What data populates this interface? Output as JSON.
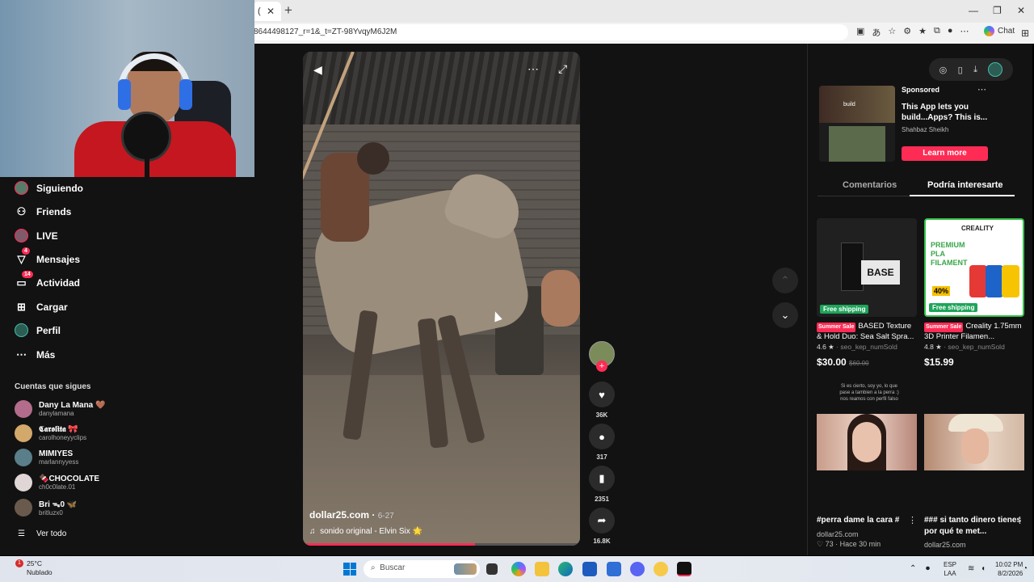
{
  "browser": {
    "tab_label": "(",
    "address": "8644498127_r=1&_t=ZT-98YvqyM6J2M",
    "chat_label": "Chat",
    "window_controls": [
      "—",
      "❐",
      "✕"
    ]
  },
  "sidebar": {
    "items": [
      {
        "label": "Siguiendo",
        "icon": "avatar-icon"
      },
      {
        "label": "Friends",
        "icon": "people-icon"
      },
      {
        "label": "LIVE",
        "icon": "live-icon"
      },
      {
        "label": "Mensajes",
        "icon": "send-icon",
        "badge": "4"
      },
      {
        "label": "Actividad",
        "icon": "inbox-icon",
        "badge": "14"
      },
      {
        "label": "Cargar",
        "icon": "upload-icon"
      },
      {
        "label": "Perfil",
        "icon": "profile-icon"
      },
      {
        "label": "Más",
        "icon": "more-icon"
      }
    ],
    "following_title": "Cuentas que sigues",
    "following": [
      {
        "name": "Dany La Mana 🤎",
        "user": "danylamana"
      },
      {
        "name": "𝕮𝖆𝖗𝖔𝖑𝖎𝖙𝖆 🎀",
        "user": "carolhoneyyclips"
      },
      {
        "name": "MIMIYES",
        "user": "marlannyyess"
      },
      {
        "name": "🍫CHOCOLATE",
        "user": "ch0c0late.01"
      },
      {
        "name": "Bri ᯓ0 🦋",
        "user": "britluzx0"
      }
    ],
    "see_all": "Ver todo"
  },
  "video": {
    "author": "dollar25.com",
    "date": "6-27",
    "sound": "sonido original - Elvin Six 🌟",
    "progress": 0.62
  },
  "actions": {
    "likes": "36K",
    "comments": "317",
    "saves": "2351",
    "shares": "16.8K"
  },
  "ad": {
    "sponsored": "Sponsored",
    "title": "This App lets you build...Apps? This is...",
    "author": "Shahbaz Sheikh",
    "cta": "Learn more",
    "thumb_text": "build"
  },
  "right_tabs": {
    "comments": "Comentarios",
    "related": "Podría interesarte"
  },
  "products": [
    {
      "shipping": "Free shipping",
      "sale": "Summer Sale",
      "title": "BASED Texture & Hold Duo: Sea Salt Spra...",
      "rating": "4.6 ★",
      "sold": "seo_kep_numSold",
      "price": "$30.00",
      "old_price": "$60.00",
      "img_text": "BASE"
    },
    {
      "shipping": "Free shipping",
      "sale": "Summer Sale",
      "title": "Creality 1.75mm 3D Printer Filamen...",
      "rating": "4.8 ★",
      "sold": "seo_kep_numSold",
      "price": "$15.99",
      "img_text": "PREMIUM PLA FILAMENT",
      "brand": "CREALITY",
      "discount": "40%"
    }
  ],
  "videos": [
    {
      "title": "#perra dame la cara #",
      "author": "dollar25.com",
      "meta": "♡ 73 · Hace 30 min"
    },
    {
      "title": "### si tanto dinero tienes por qué te met...",
      "author": "dollar25.com"
    }
  ],
  "faint_caption": "Si es cierto, soy yo, lo que pase a tambien a la perra :) nos reamos con perfil falso",
  "taskbar": {
    "temp": "25°C",
    "weather": "Nublado",
    "weather_badge": "1",
    "search": "Buscar",
    "lang": "ESP",
    "region": "LAA",
    "time": "10:02 PM",
    "date": "8/2/2026"
  },
  "colors": {
    "accent": "#fe2c55",
    "background": "#121212",
    "shipping": "#1fa45a"
  }
}
